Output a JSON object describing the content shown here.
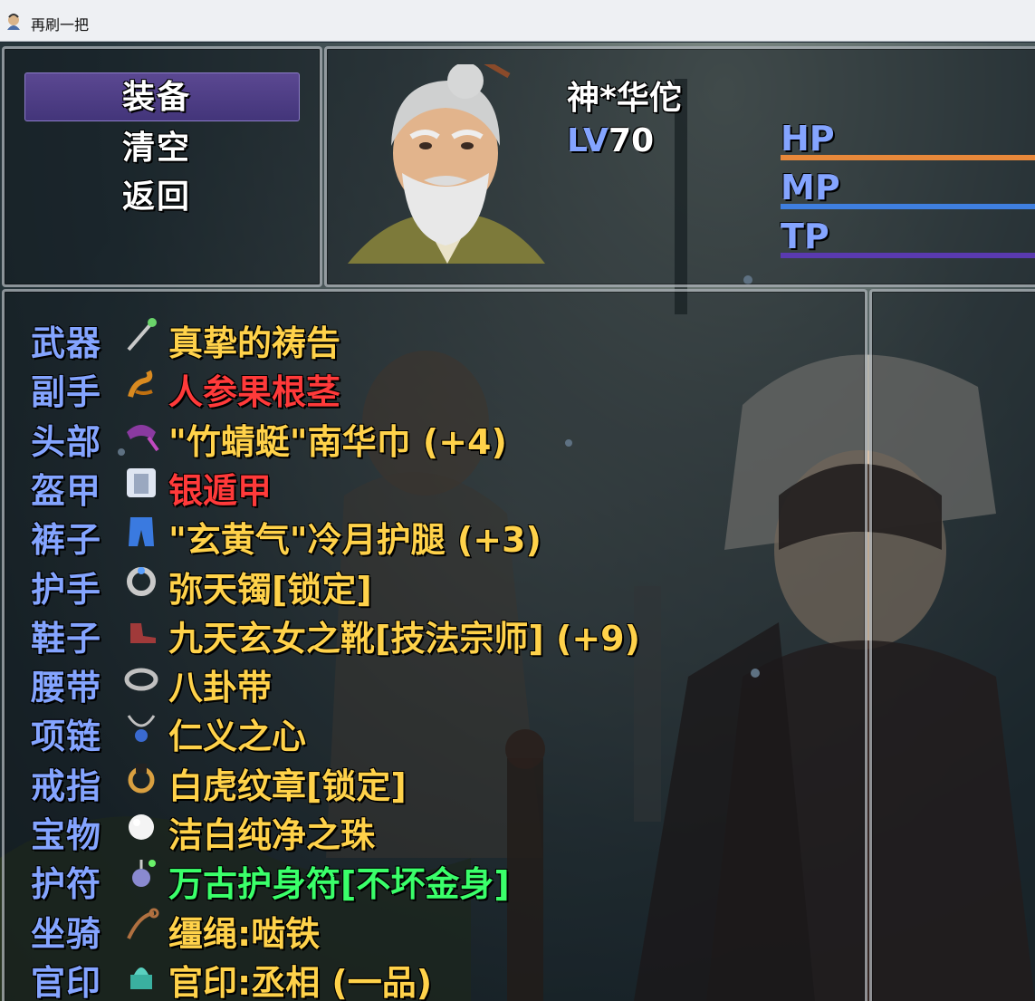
{
  "window": {
    "title": "再刷一把",
    "app_icon": "game-app-icon"
  },
  "commands": [
    {
      "label": "装备",
      "selected": true
    },
    {
      "label": "清空",
      "selected": false
    },
    {
      "label": "返回",
      "selected": false
    }
  ],
  "actor": {
    "name": "神*华佗",
    "level_label": "LV",
    "level": "70",
    "gauges": [
      {
        "label": "HP",
        "color": "#e8883a",
        "fill": 1.0
      },
      {
        "label": "MP",
        "color": "#3f7fe0",
        "fill": 1.0
      },
      {
        "label": "TP",
        "color": "#5a3ab0",
        "fill": 1.0
      }
    ]
  },
  "slots": [
    {
      "slot": "武器",
      "item": "真挚的祷告",
      "color": "#ffd24a",
      "icon": "staff-icon"
    },
    {
      "slot": "副手",
      "item": "人参果根茎",
      "color": "#ff3a3a",
      "icon": "root-icon"
    },
    {
      "slot": "头部",
      "item": "\"竹蜻蜓\"南华巾 (+4)",
      "color": "#ffd24a",
      "icon": "headscarf-icon"
    },
    {
      "slot": "盔甲",
      "item": "银遁甲",
      "color": "#ff3a3a",
      "icon": "armor-icon"
    },
    {
      "slot": "裤子",
      "item": "\"玄黄气\"冷月护腿 (+3)",
      "color": "#ffd24a",
      "icon": "pants-icon"
    },
    {
      "slot": "护手",
      "item": "弥天镯[锁定]",
      "color": "#ffd24a",
      "icon": "bracelet-icon"
    },
    {
      "slot": "鞋子",
      "item": "九天玄女之靴[技法宗师] (+9)",
      "color": "#ffd24a",
      "icon": "boots-icon"
    },
    {
      "slot": "腰带",
      "item": "八卦带",
      "color": "#ffd24a",
      "icon": "belt-icon"
    },
    {
      "slot": "项链",
      "item": "仁义之心",
      "color": "#ffd24a",
      "icon": "necklace-icon"
    },
    {
      "slot": "戒指",
      "item": "白虎纹章[锁定]",
      "color": "#ffd24a",
      "icon": "ring-icon"
    },
    {
      "slot": "宝物",
      "item": "洁白纯净之珠",
      "color": "#ffd24a",
      "icon": "pearl-icon"
    },
    {
      "slot": "护符",
      "item": "万古护身符[不坏金身]",
      "color": "#3aff6a",
      "icon": "amulet-icon"
    },
    {
      "slot": "坐骑",
      "item": "缰绳:啮铁",
      "color": "#ffd24a",
      "icon": "rein-icon"
    },
    {
      "slot": "官印",
      "item": "官印:丞相 (一品)",
      "color": "#ffd24a",
      "icon": "seal-icon"
    }
  ]
}
